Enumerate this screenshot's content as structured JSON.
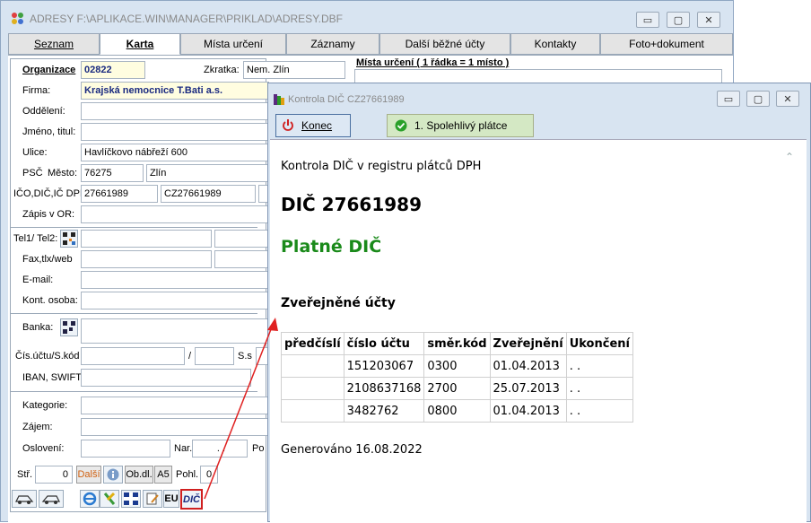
{
  "main_window": {
    "title": "ADRESY F:\\APLIKACE.WIN\\MANAGER\\PRIKLAD\\ADRESY.DBF",
    "tabs": [
      "Seznam",
      "Karta",
      "Místa určení",
      "Záznamy",
      "Další běžné účty",
      "Kontakty",
      "Foto+dokument"
    ],
    "active_tab": "Karta",
    "mista_urceni_header": "Místa určení ( 1 řádka = 1 místo )"
  },
  "form": {
    "organizace_label": "Organizace",
    "organizace_value": "02822",
    "zkratka_label": "Zkratka:",
    "zkratka_value": "Nem. Zlín",
    "firma_label": "Firma:",
    "firma_value": "Krajská nemocnice T.Bati a.s.",
    "oddeleni_label": "Oddělení:",
    "jmeno_label": "Jméno, titul:",
    "ulice_label": "Ulice:",
    "ulice_value": "Havlíčkovo nábřeží 600",
    "psc_label": "PSČ",
    "mesto_label": "Město:",
    "psc_value": "76275",
    "mesto_value": "Zlín",
    "ico_label": "IČO,DIČ,IČ DPH",
    "ico_value": "27661989",
    "dic_value": "CZ27661989",
    "zapis_label": "Zápis v OR:",
    "tel_label": "Tel1/ Tel2:",
    "fax_label": "Fax,tlx/web",
    "email_label": "E-mail:",
    "kont_label": "Kont. osoba:",
    "banka_label": "Banka:",
    "cis_label": "Čís.účtu/S.kód",
    "slash": "/",
    "ss_label": "S.s",
    "iban_label": "IBAN, SWIFT",
    "kategorie_label": "Kategorie:",
    "zajem_label": "Zájem:",
    "osloveni_label": "Oslovení:",
    "nar_label": "Nar.",
    "nar_value": ". .",
    "po_label": "Po",
    "str_label": "Stř.",
    "str_value": "0",
    "dalsi_label": "Další",
    "obdl_label": "Ob.dl.",
    "a5_label": "A5",
    "pohl_label": "Pohl.",
    "pohl_value": "0",
    "eu_label": "EU",
    "dic_btn_label": "DIČ"
  },
  "dialog": {
    "title": "Kontrola DIČ CZ27661989",
    "konec_label": "Konec",
    "spol_label": "1. Spolehlivý plátce",
    "heading": "Kontrola DIČ v registru plátců DPH",
    "dic_heading": "DIČ 27661989",
    "status": "Platné DIČ",
    "status_color": "#1a8a1a",
    "accounts_heading": "Zveřejněné účty",
    "table_headers": [
      "předčíslí",
      "číslo účtu",
      "směr.kód",
      "Zveřejnění",
      "Ukončení"
    ],
    "table_rows": [
      [
        "",
        "151203067",
        "0300",
        "01.04.2013",
        ". ."
      ],
      [
        "",
        "2108637168",
        "2700",
        "25.07.2013",
        ". ."
      ],
      [
        "",
        "3482762",
        "0800",
        "01.04.2013",
        ". ."
      ]
    ],
    "generated": "Generováno 16.08.2022"
  },
  "window_buttons": {
    "minimize": "▭",
    "maximize": "▢",
    "close": "✕"
  }
}
